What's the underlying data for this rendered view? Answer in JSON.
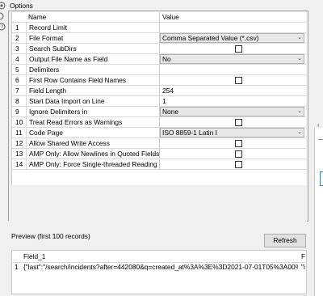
{
  "options": {
    "title": "Options",
    "columns": {
      "name": "Name",
      "value": "Value"
    },
    "rows": [
      {
        "num": "1",
        "name": "Record Limit",
        "type": "text",
        "value": ""
      },
      {
        "num": "2",
        "name": "File Format",
        "type": "dropdown",
        "value": "Comma Separated Value (*.csv)"
      },
      {
        "num": "3",
        "name": "Search SubDirs",
        "type": "checkbox",
        "checked": false
      },
      {
        "num": "4",
        "name": "Output File Name as Field",
        "type": "dropdown",
        "value": "No"
      },
      {
        "num": "5",
        "name": "Delimiters",
        "type": "text",
        "value": ""
      },
      {
        "num": "6",
        "name": "First Row Contains Field Names",
        "type": "checkbox",
        "checked": false
      },
      {
        "num": "7",
        "name": "Field Length",
        "type": "text",
        "value": "254"
      },
      {
        "num": "8",
        "name": "Start Data Import on Line",
        "type": "text",
        "value": "1"
      },
      {
        "num": "9",
        "name": "Ignore Delimiters in",
        "type": "dropdown",
        "value": "None"
      },
      {
        "num": "10",
        "name": "Treat Read Errors as Warnings",
        "type": "checkbox",
        "checked": false
      },
      {
        "num": "11",
        "name": "Code Page",
        "type": "dropdown",
        "value": "ISO 8859-1 Latin I"
      },
      {
        "num": "12",
        "name": "Allow Shared Write Access",
        "type": "checkbox",
        "checked": false
      },
      {
        "num": "13",
        "name": "AMP Only: Allow Newlines in Quoted Fields",
        "type": "checkbox",
        "checked": false
      },
      {
        "num": "14",
        "name": "AMP Only: Force Single-threaded Reading",
        "type": "checkbox",
        "checked": false
      }
    ]
  },
  "preview": {
    "title": "Preview (first 100 records)",
    "refresh_label": "Refresh",
    "columns": [
      "Field_1",
      "F"
    ],
    "rows": [
      {
        "num": "1",
        "cells": [
          "{\"last\":\"/search/incidents?after=442080&q=created_at%3A%3E%3D2021-07-01T05%3A00%3A00Z\"",
          "\"i"
        ]
      }
    ]
  },
  "icons": [
    "settings-icon",
    "refresh-icon",
    "help-icon",
    "chevron-down-icon",
    "collapse-arrow-icon"
  ]
}
